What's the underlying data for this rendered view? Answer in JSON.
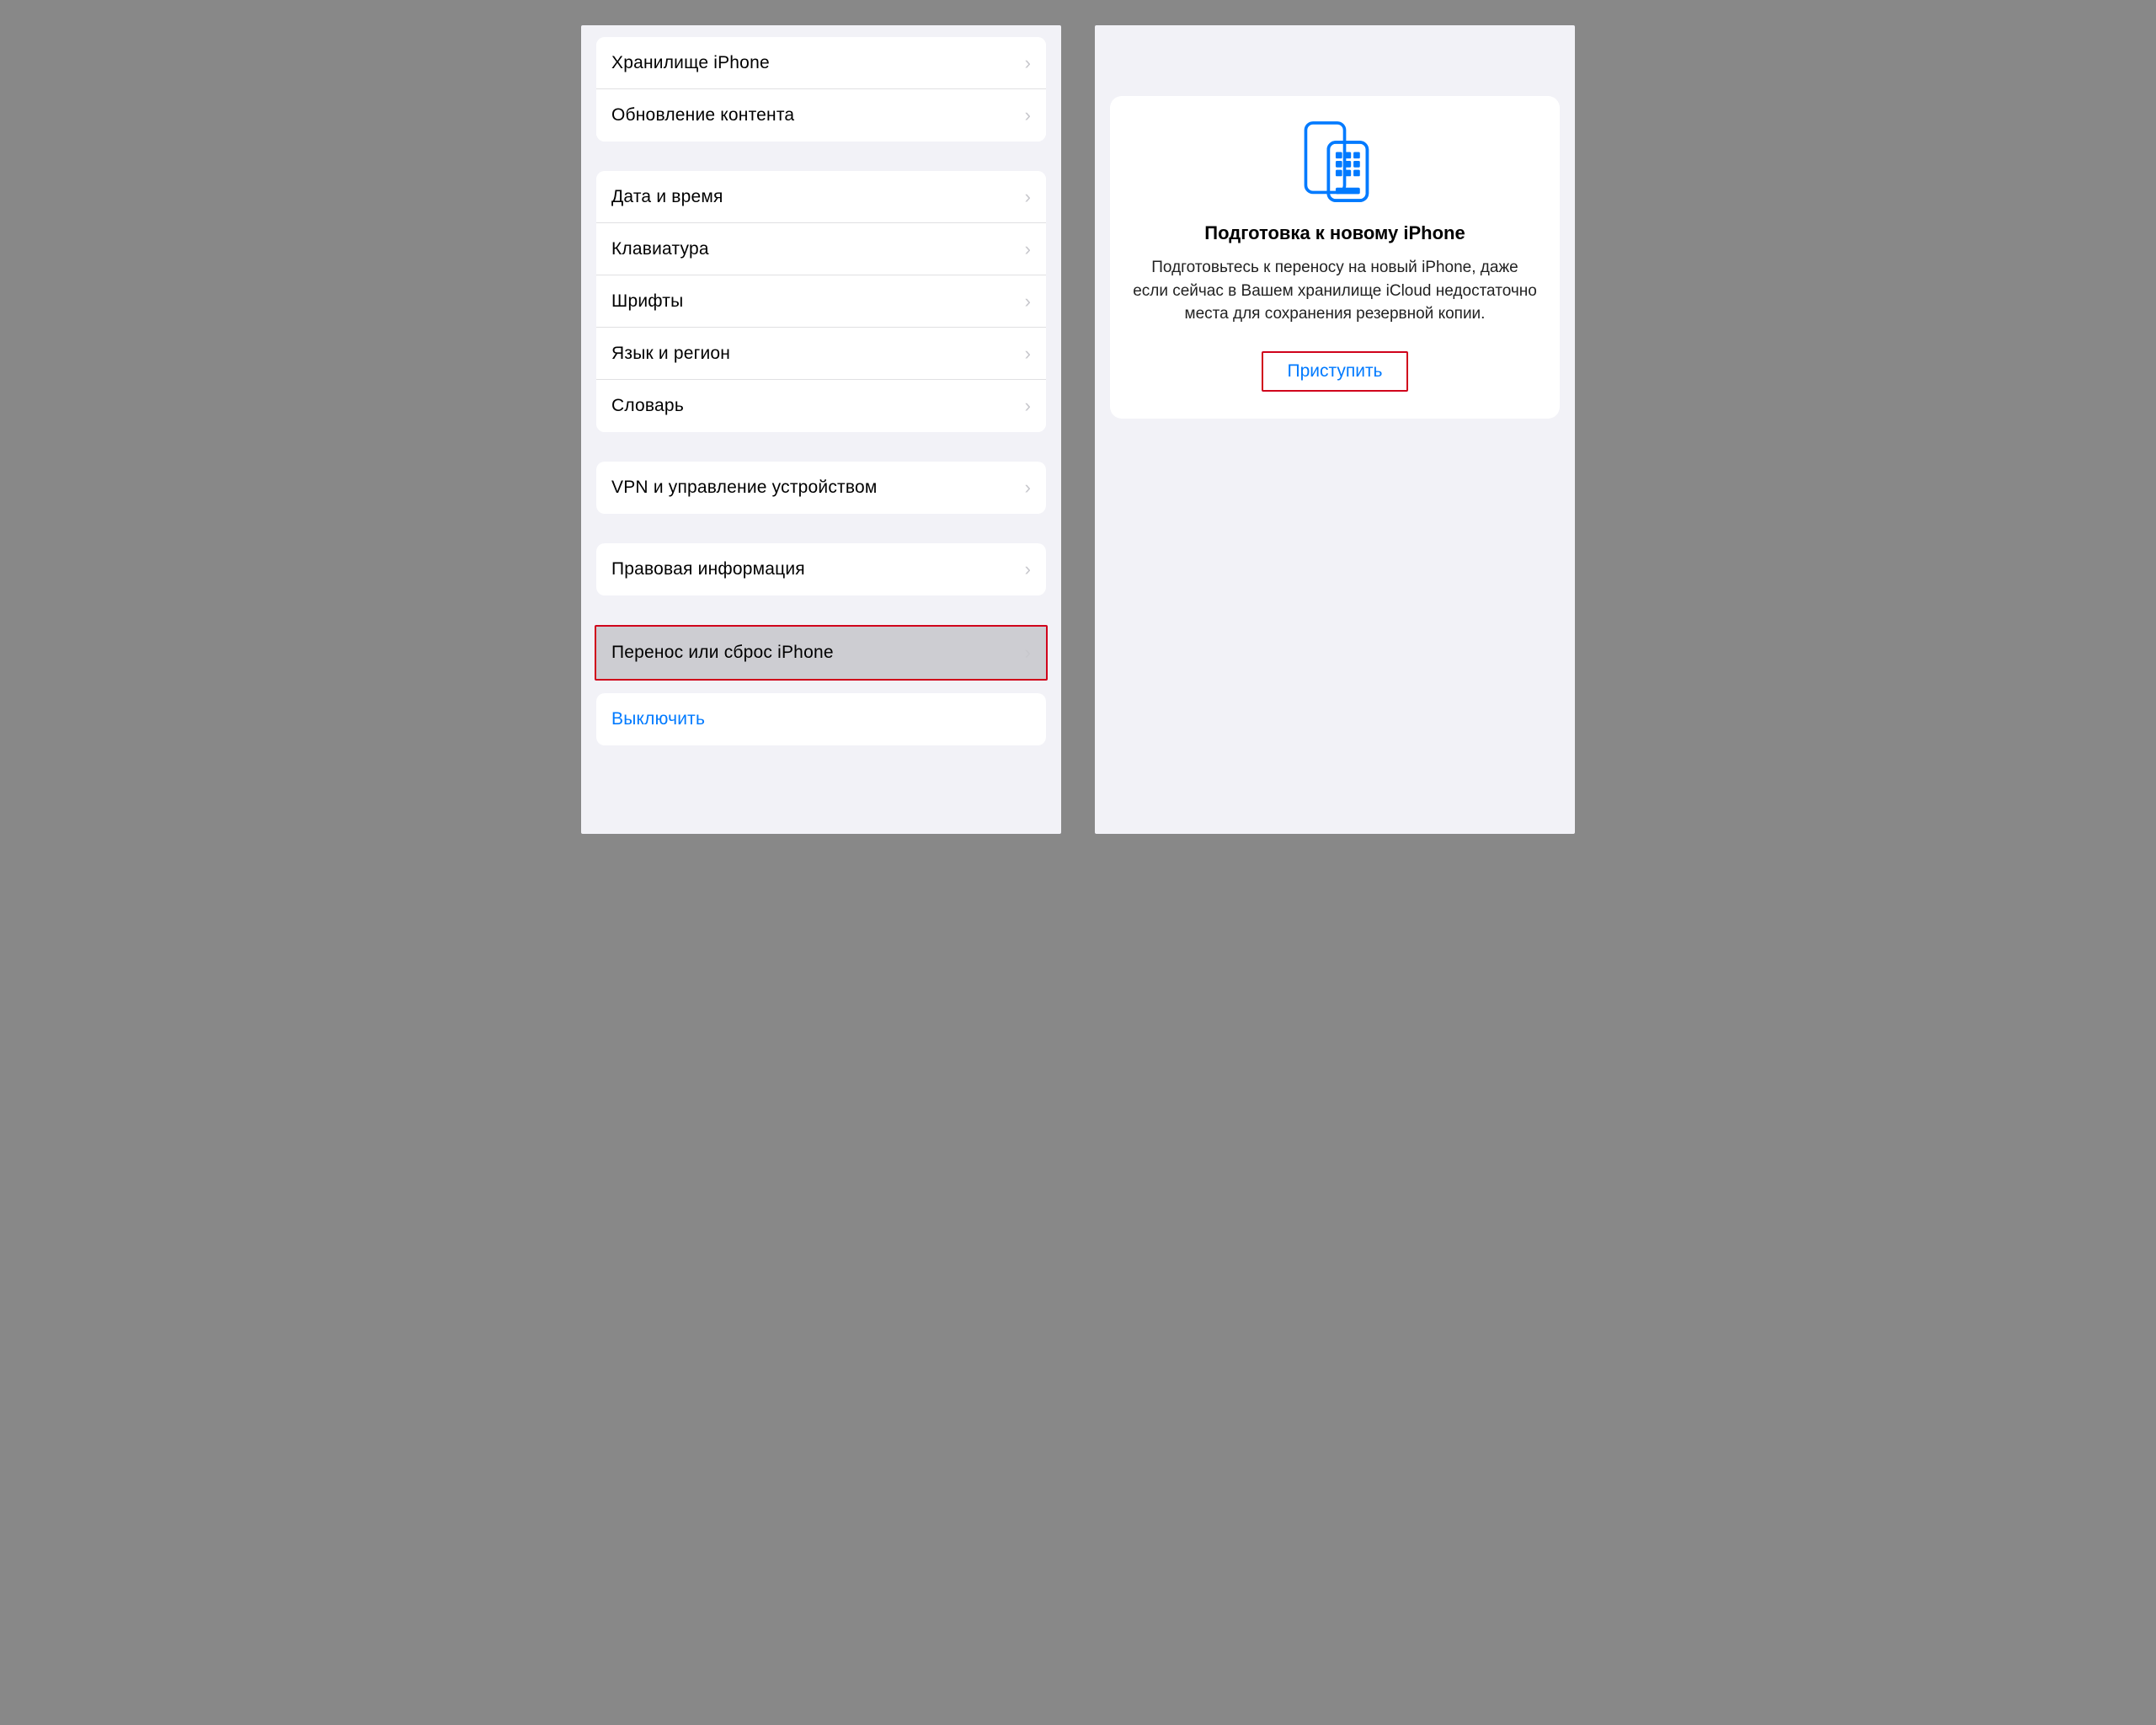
{
  "left": {
    "group1": [
      {
        "label": "Хранилище iPhone"
      },
      {
        "label": "Обновление контента"
      }
    ],
    "group2": [
      {
        "label": "Дата и время"
      },
      {
        "label": "Клавиатура"
      },
      {
        "label": "Шрифты"
      },
      {
        "label": "Язык и регион"
      },
      {
        "label": "Словарь"
      }
    ],
    "group3": [
      {
        "label": "VPN и управление устройством"
      }
    ],
    "group4": [
      {
        "label": "Правовая информация"
      }
    ],
    "group5": {
      "transfer": "Перенос или сброс iPhone",
      "shutdown": "Выключить"
    }
  },
  "right": {
    "title": "Подготовка к новому iPhone",
    "body": "Подготовьтесь к переносу на новый iPhone, даже если сейчас в Вашем хранилище iCloud недостаточно места для сохранения резервной копии.",
    "button": "Приступить"
  }
}
